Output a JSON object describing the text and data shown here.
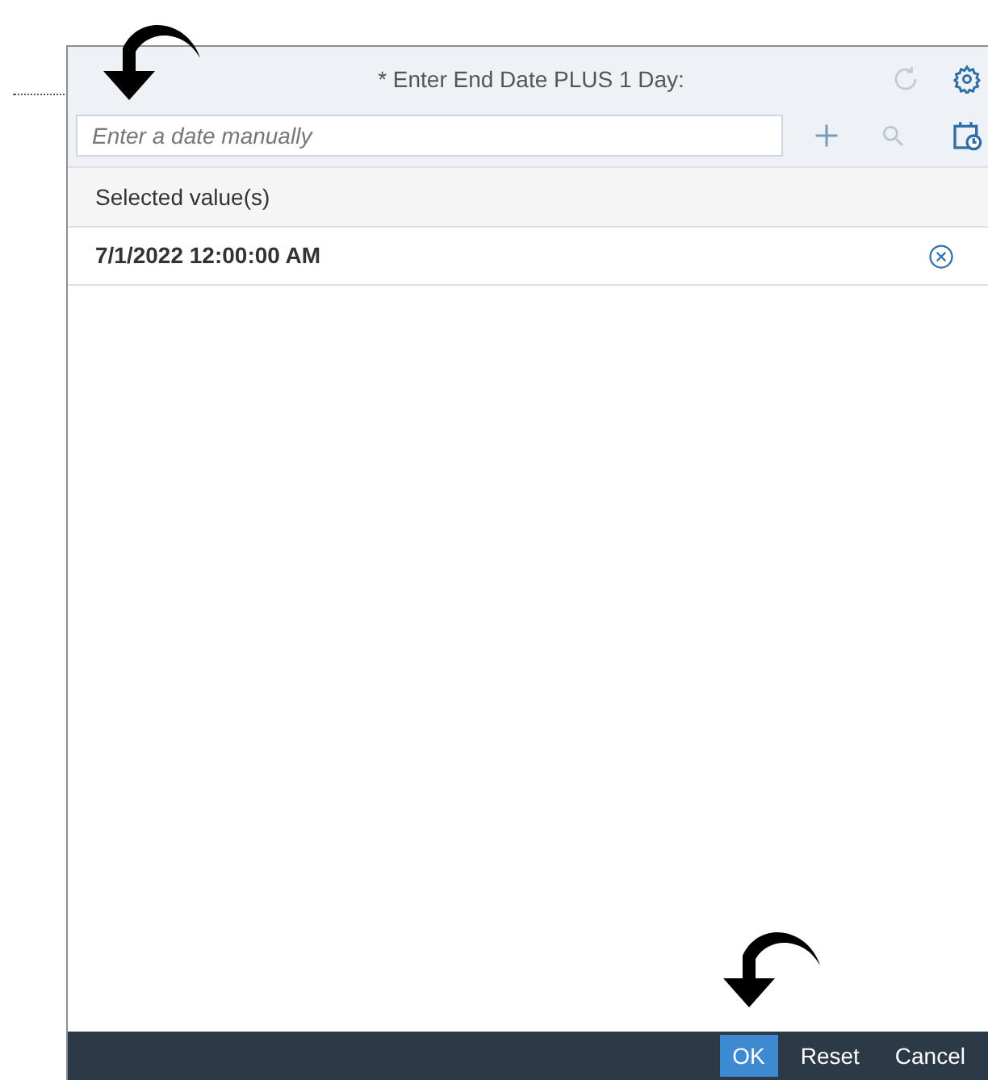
{
  "dialog": {
    "title": "* Enter End Date PLUS 1 Day:"
  },
  "search": {
    "placeholder": "Enter a date manually"
  },
  "list": {
    "header": "Selected value(s)",
    "items": [
      "7/1/2022 12:00:00 AM"
    ]
  },
  "buttons": [
    {
      "label": "OK",
      "selected": true
    },
    {
      "label": "Reset",
      "selected": false
    },
    {
      "label": "Cancel",
      "selected": false
    }
  ]
}
